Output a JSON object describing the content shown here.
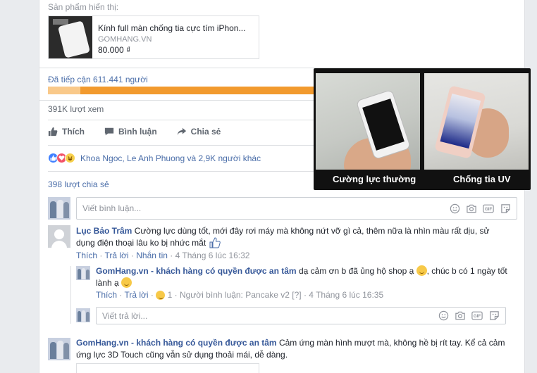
{
  "products": {
    "label": "Sản phẩm hiển thị:",
    "item": {
      "title": "Kính full màn chống tia cực tím iPhon...",
      "site": "GOMHANG.VN",
      "price": "80.000 ₫"
    }
  },
  "reach": {
    "label": "Đã tiếp cận 611.441 người",
    "fraction_light": 0.12
  },
  "views": "391K lượt xem",
  "actions": {
    "like": "Thích",
    "comment": "Bình luận",
    "share": "Chia sẻ"
  },
  "reactions": {
    "text": "Khoa Ngoc, Le Anh Phuong và 2,9K người khác",
    "icons": [
      "like-icon",
      "love-icon",
      "haha-icon"
    ]
  },
  "shares": "398 lượt chia sẻ",
  "comment_input": {
    "placeholder": "Viết bình luận...",
    "icons": [
      "emoji-icon",
      "camera-icon",
      "gif-icon",
      "sticker-icon"
    ]
  },
  "comments": [
    {
      "name": "Lục Bảo Trâm",
      "text": "Cường lực dùng tốt, mới đây rơi máy mà không nứt vỡ gì cả, thêm nữa là nhìn màu rất dịu, sử dụng điện thoại lâu ko bị nhức mắt",
      "meta": {
        "like": "Thích",
        "reply": "Trả lời",
        "message": "Nhắn tin",
        "time": "4 Tháng 6 lúc 16:32"
      }
    }
  ],
  "reply": {
    "name": "GomHang.vn - khách hàng có quyền được an tâm",
    "text": "dạ cảm ơn b đã ủng hộ shop ạ",
    "text2": ", chúc b có 1 ngày tốt lành ạ",
    "meta": {
      "like": "Thích",
      "reply": "Trả lời",
      "reaction_count": "1",
      "commenter": "Người bình luận: Pancake v2",
      "help": "[?]",
      "time": "4 Tháng 6 lúc 16:35"
    }
  },
  "reply_input": {
    "placeholder": "Viết trả lời..."
  },
  "comment2": {
    "name": "GomHang.vn - khách hàng có quyền được an tâm",
    "text": "Cảm ứng màn hình mượt mà, không hề bị rít tay. Kể cả cảm ứng lực 3D Touch cũng vẫn sử dụng thoải mái, dễ dàng."
  },
  "video": {
    "caption_left": "Cường lực thường",
    "caption_right": "Chống tia UV"
  }
}
